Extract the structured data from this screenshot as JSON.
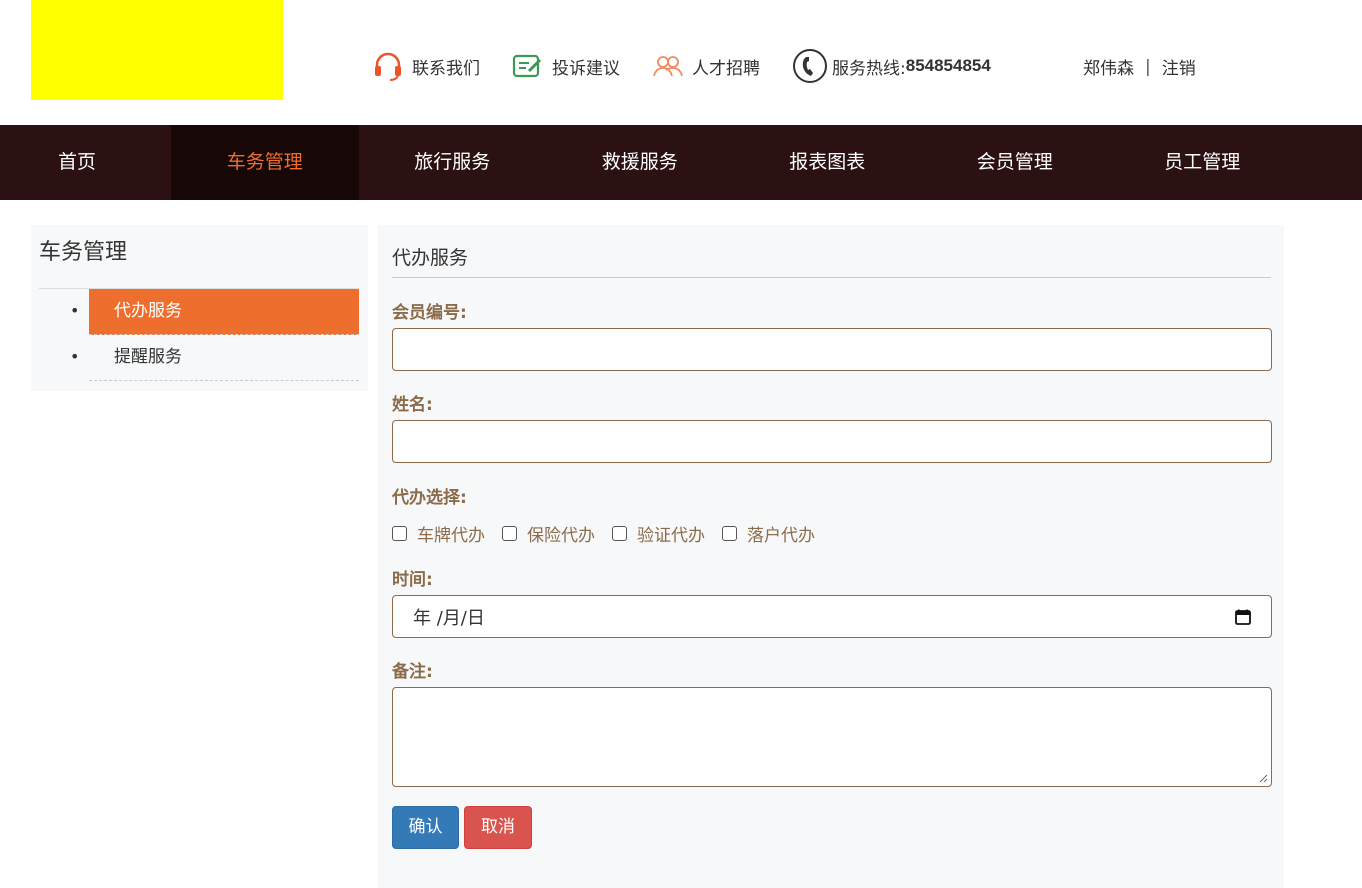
{
  "header": {
    "links": [
      {
        "label": "联系我们",
        "icon": "headset-icon"
      },
      {
        "label": "投诉建议",
        "icon": "feedback-icon"
      },
      {
        "label": "人才招聘",
        "icon": "people-icon"
      }
    ],
    "hotline_label": "服务热线:",
    "hotline_number": "854854854",
    "user_name": "郑伟森",
    "separator": "|",
    "logout_label": "注销"
  },
  "nav": {
    "items": [
      "首页",
      "车务管理",
      "旅行服务",
      "救援服务",
      "报表图表",
      "会员管理",
      "员工管理"
    ],
    "active_index": 1
  },
  "sidebar": {
    "title": "车务管理",
    "items": [
      "代办服务",
      "提醒服务"
    ],
    "active_index": 0
  },
  "form": {
    "title": "代办服务",
    "member_id_label": "会员编号:",
    "member_id_value": "",
    "name_label": "姓名:",
    "name_value": "",
    "service_label": "代办选择:",
    "services": [
      "车牌代办",
      "保险代办",
      "验证代办",
      "落户代办"
    ],
    "time_label": "时间:",
    "date_placeholder": "年 /月/日",
    "remark_label": "备注:",
    "remark_value": "",
    "confirm_label": "确认",
    "cancel_label": "取消"
  },
  "colors": {
    "nav_bg": "#2b1112",
    "accent": "#ee6f2d",
    "label": "#8b6b4a",
    "confirm": "#337ab7",
    "cancel": "#d9534f",
    "logo": "#ffff00"
  }
}
